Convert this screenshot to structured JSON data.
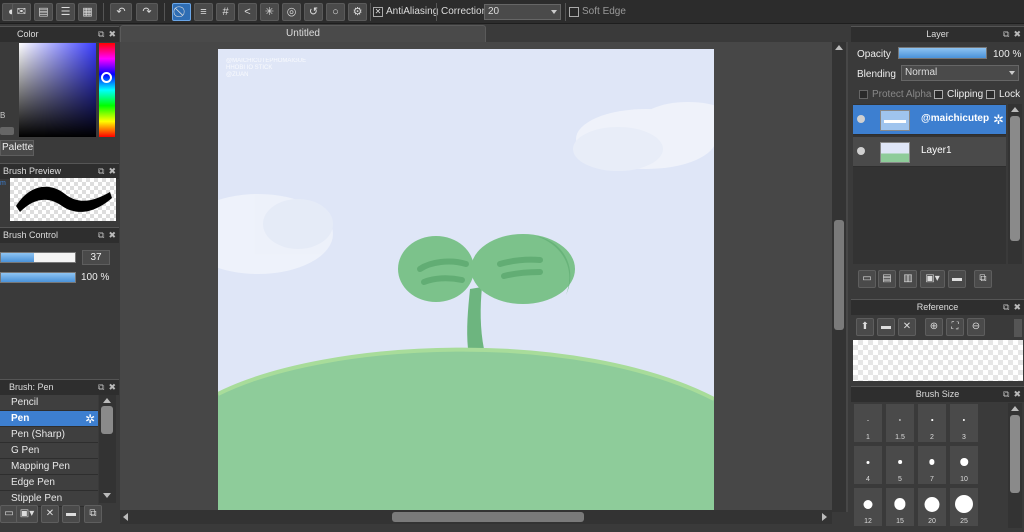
{
  "toolbar": {
    "antialiasing_label": "AntiAliasing",
    "correction_label": "Correction",
    "correction_value": "20",
    "soft_edge_label": "Soft Edge"
  },
  "document": {
    "tab_title": "Untitled",
    "watermark": [
      "@MAICHICUTEPHOMAIGUE",
      "HHOBI IO STICK",
      "@ZUAN"
    ]
  },
  "color_panel": {
    "title": "Color",
    "palette_label": "Palette"
  },
  "brush_preview_panel": {
    "title": "Brush Preview"
  },
  "brush_control_panel": {
    "title": "Brush Control",
    "size_value": "37",
    "opacity_value": "100 %",
    "size_fraction": 0.45,
    "opacity_fraction": 1.0
  },
  "brush_panel": {
    "title": "Brush: Pen",
    "items": [
      "Pencil",
      "Pen",
      "Pen (Sharp)",
      "G Pen",
      "Mapping Pen",
      "Edge Pen",
      "Stipple Pen"
    ],
    "selected_index": 1
  },
  "layer_panel": {
    "title": "Layer",
    "opacity_label": "Opacity",
    "opacity_value": "100 %",
    "blending_label": "Blending",
    "blending_value": "Normal",
    "protect_alpha_label": "Protect Alpha",
    "clipping_label": "Clipping",
    "lock_label": "Lock",
    "layers": [
      {
        "name": "@maichicutep",
        "selected": true
      },
      {
        "name": "Layer1",
        "selected": false
      }
    ]
  },
  "reference_panel": {
    "title": "Reference"
  },
  "brush_size_panel": {
    "title": "Brush Size",
    "sizes": [
      "1",
      "1.5",
      "2",
      "3",
      "4",
      "5",
      "7",
      "10",
      "12",
      "15",
      "20",
      "25"
    ]
  },
  "colors": {
    "accent": "#3d7fd0",
    "sky": "#dfe6f7",
    "hill": "#8ecc9a",
    "sprout": "#72bd84"
  }
}
